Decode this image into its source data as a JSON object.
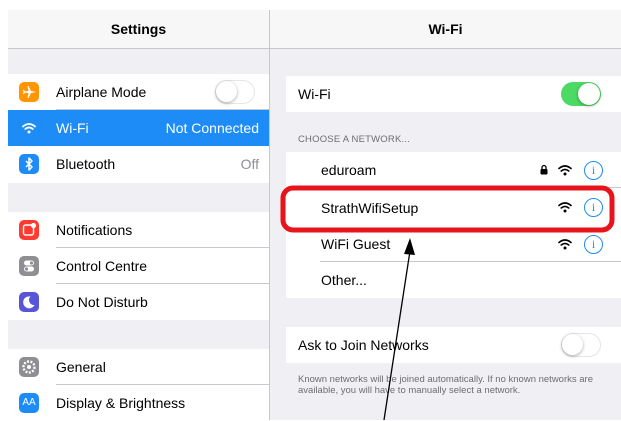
{
  "left": {
    "title": "Settings",
    "group1": [
      {
        "label": "Airplane Mode",
        "icon": "airplane-icon",
        "color": "#ff9500",
        "toggle": "off"
      },
      {
        "label": "Wi-Fi",
        "icon": "wifi-icon",
        "color": "#1d8cf7",
        "value": "Not Connected",
        "selected": true
      },
      {
        "label": "Bluetooth",
        "icon": "bluetooth-icon",
        "color": "#1d8cf7",
        "value": "Off"
      }
    ],
    "group2": [
      {
        "label": "Notifications",
        "icon": "notifications-icon",
        "color": "#ff3b30"
      },
      {
        "label": "Control Centre",
        "icon": "control-centre-icon",
        "color": "#8e8e93"
      },
      {
        "label": "Do Not Disturb",
        "icon": "moon-icon",
        "color": "#5856d6"
      }
    ],
    "group3": [
      {
        "label": "General",
        "icon": "gear-icon",
        "color": "#8e8e93"
      },
      {
        "label": "Display & Brightness",
        "icon": "display-icon",
        "color": "#1d8cf7",
        "icon_text": "AA"
      }
    ]
  },
  "right": {
    "title": "Wi-Fi",
    "wifi_label": "Wi-Fi",
    "wifi_toggle": "on",
    "section_header": "CHOOSE A NETWORK...",
    "networks": [
      {
        "name": "eduroam",
        "locked": true
      },
      {
        "name": "StrathWifiSetup",
        "locked": false
      },
      {
        "name": "WiFi Guest",
        "locked": false
      }
    ],
    "other_label": "Other...",
    "ask_label": "Ask to Join Networks",
    "ask_toggle": "off",
    "footer": "Known networks will be joined automatically. If no known networks are available, you will have to manually select a network."
  },
  "annotation": {
    "highlight_color": "#e8141c",
    "highlighted_network": "StrathWifiSetup"
  },
  "colors": {
    "accent": "#1d8cf7",
    "toggle_on": "#4cd964",
    "group_bg": "#efeff4"
  }
}
